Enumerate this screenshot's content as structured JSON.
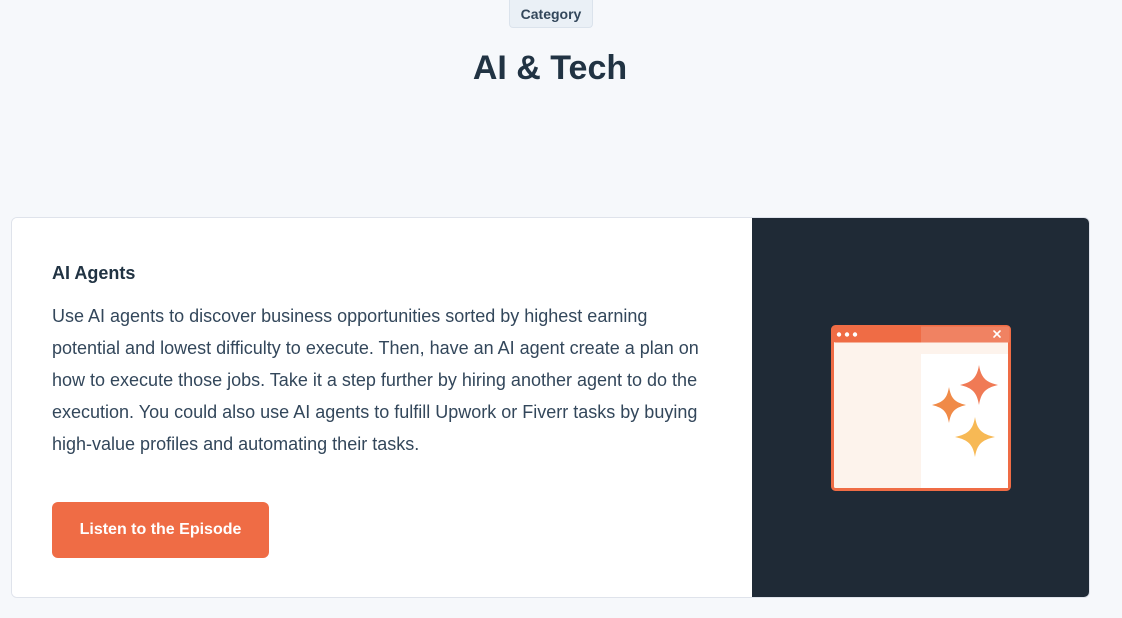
{
  "category": {
    "label": "Category"
  },
  "page": {
    "title": "AI & Tech"
  },
  "card": {
    "heading": "AI Agents",
    "description": "Use AI agents to discover business opportunities sorted by highest earning potential and lowest difficulty to execute. Then, have an AI agent create a plan on how to execute those jobs. Take it a step further by hiring another agent to do the execution. You could also use AI agents to fulfill Upwork or Fiverr tasks by buying high-value profiles and automating their tasks.",
    "button_label": "Listen to the Episode",
    "illustration_icon": "browser-window-sparkles-icon"
  },
  "colors": {
    "accent": "#ef6c45",
    "background": "#f6f8fb",
    "dark_panel": "#1f2a36",
    "text_dark": "#213343"
  }
}
